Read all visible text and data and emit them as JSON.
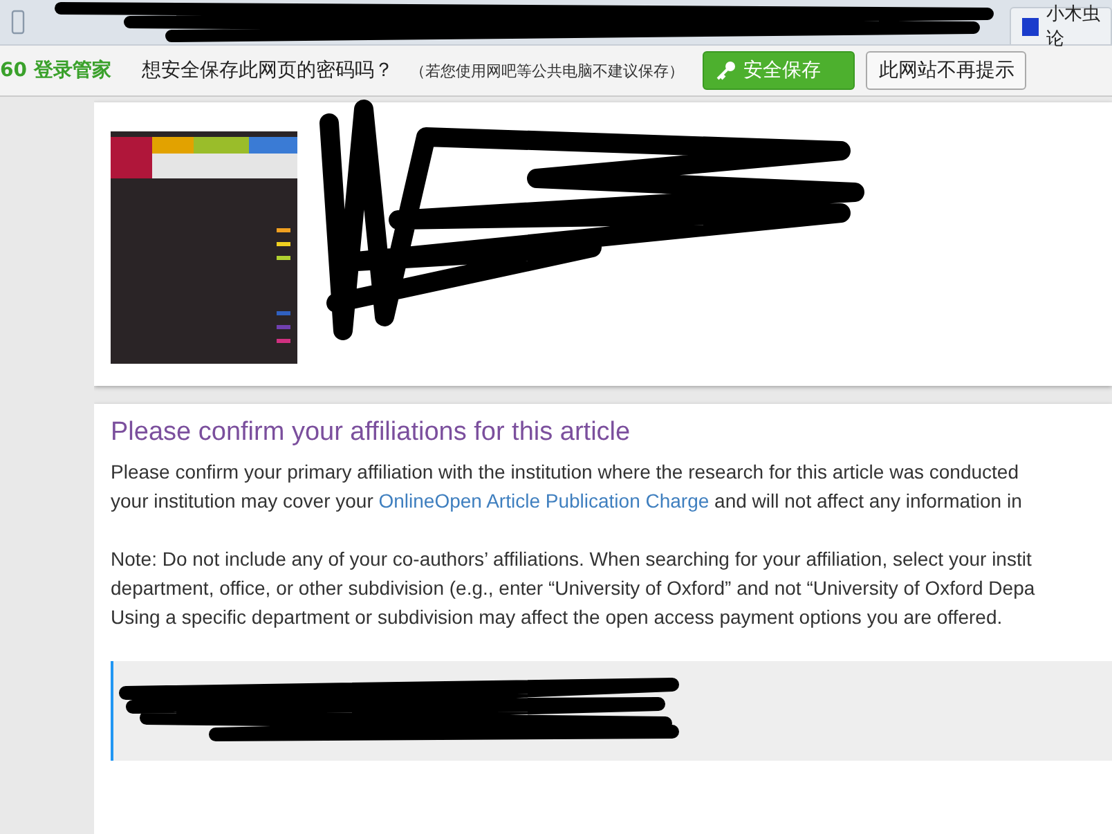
{
  "browser": {
    "tabs": [
      {
        "label": "小木虫论"
      }
    ]
  },
  "password_bar": {
    "brand": "60 登录管家",
    "prompt": "想安全保存此网页的密码吗？",
    "hint": "（若您使用网吧等公共电脑不建议保存）",
    "buttons": [
      {
        "label": "安全保存",
        "kind": "primary"
      },
      {
        "label": "此网站不再提示",
        "kind": "secondary"
      }
    ]
  },
  "affiliation": {
    "title": "Please confirm your affiliations for this article",
    "paragraphs": [
      [
        "Please confirm your primary affiliation with the institution where the research for this article was conducted",
        {
          "text": "your institution may cover your",
          "link": "OnlineOpen Article Publication Charge",
          "after": "and will not affect any information in"
        }
      ],
      [
        "Note: Do not include any of your co-authors’ affiliations. When searching for your affiliation, select your instit",
        "department, office, or other subdivision (e.g., enter “University of Oxford” and not “University of Oxford Depa",
        "Using a specific department or subdivision may affect the open access payment options you are offered."
      ]
    ]
  }
}
